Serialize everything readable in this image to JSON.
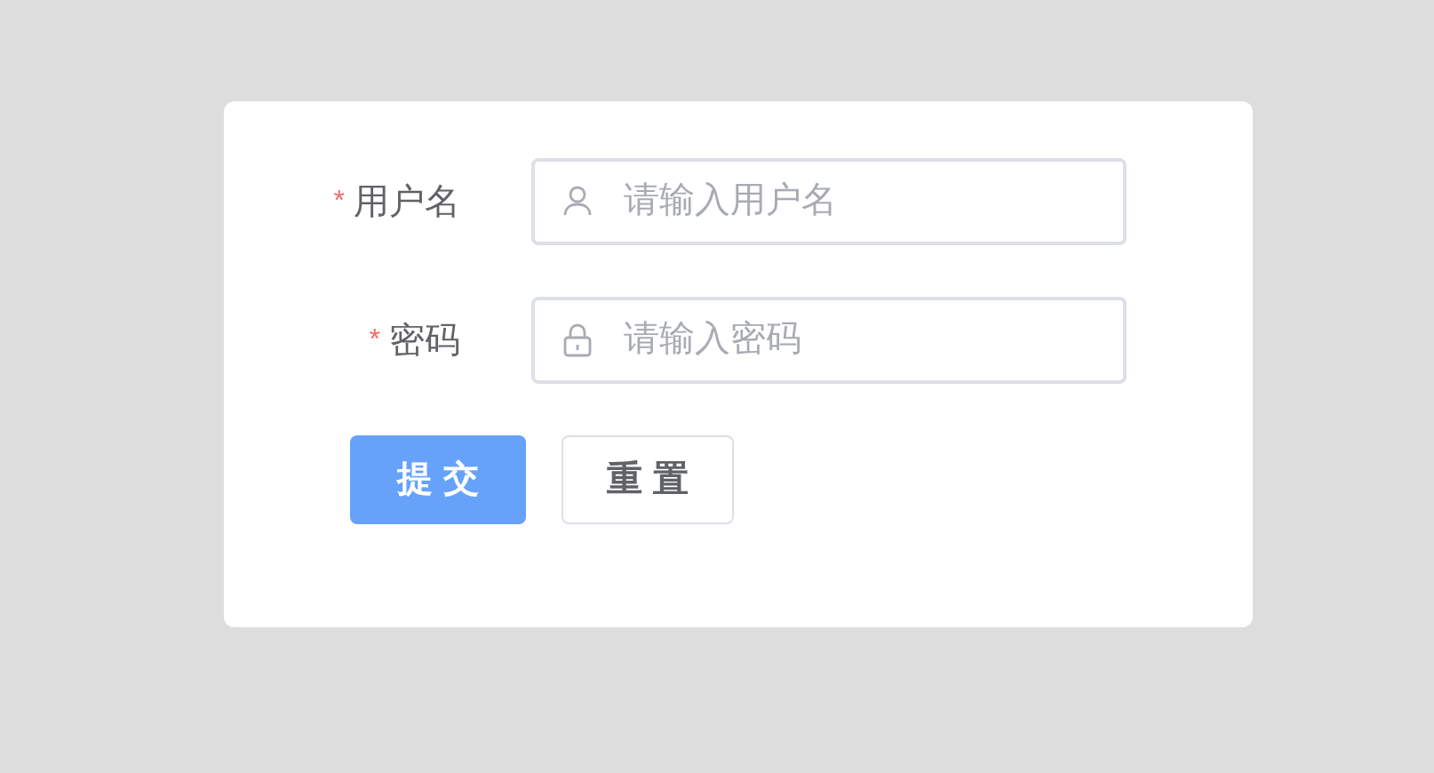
{
  "form": {
    "fields": [
      {
        "required_mark": "*",
        "label": "用户名",
        "kind": "user",
        "placeholder": "请输入用户名"
      },
      {
        "required_mark": "*",
        "label": "密码",
        "kind": "lock",
        "placeholder": "请输入密码"
      }
    ],
    "buttons": [
      {
        "label": "提 交",
        "kind": "primary"
      },
      {
        "label": "重 置",
        "kind": "default"
      }
    ]
  }
}
